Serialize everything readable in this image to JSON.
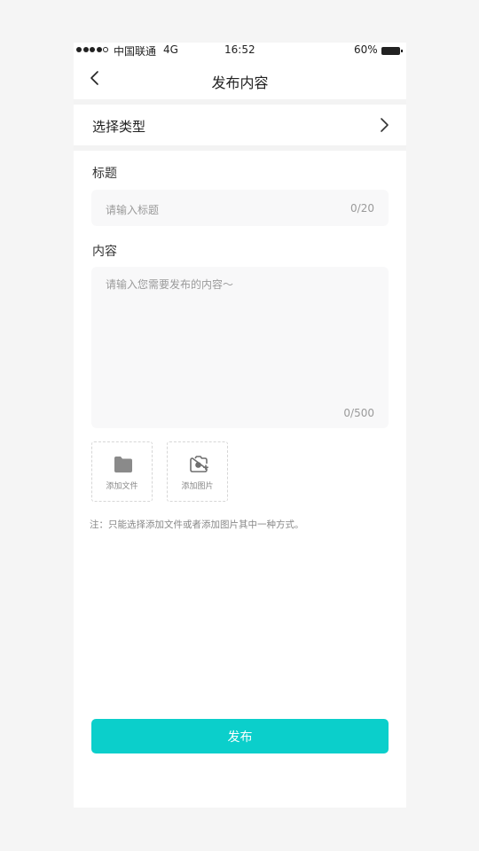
{
  "status_bar": {
    "carrier": "中国联通",
    "network": "4G",
    "time": "16:52",
    "battery": "60%"
  },
  "nav": {
    "title": "发布内容",
    "back_icon": "chevron-left-icon"
  },
  "type_selector": {
    "label": "选择类型",
    "icon": "chevron-right-icon"
  },
  "title_field": {
    "label": "标题",
    "placeholder": "请输入标题",
    "counter": "0/20"
  },
  "content_field": {
    "label": "内容",
    "placeholder": "请输入您需要发布的内容～",
    "counter": "0/500"
  },
  "attachments": [
    {
      "label": "添加文件",
      "icon": "folder-icon"
    },
    {
      "label": "添加图片",
      "icon": "camera-add-icon"
    }
  ],
  "note": "注：只能选择添加文件或者添加图片其中一种方式。",
  "publish_button": {
    "label": "发布",
    "color": "#0bcfcb"
  }
}
